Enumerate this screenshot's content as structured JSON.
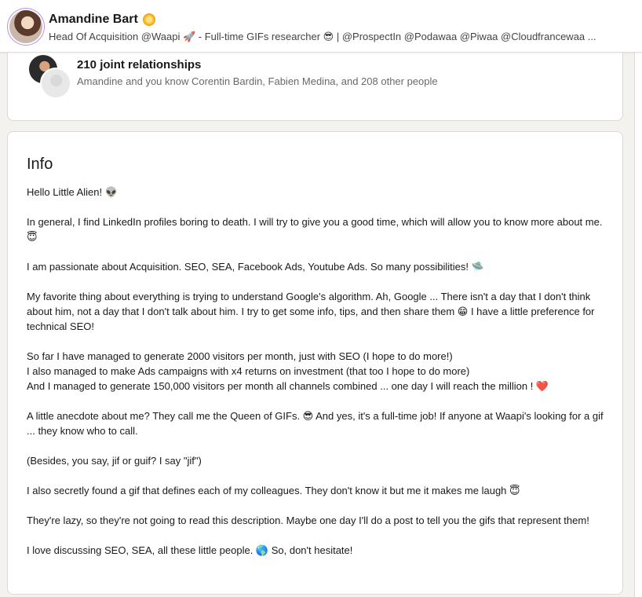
{
  "profile": {
    "name": "Amandine Bart",
    "headline": "Head Of Acquisition @Waapi 🚀 - Full-time GIFs researcher 😎 | @ProspectIn @Podawaa @Piwaa @Cloudfrancewaa ...",
    "badge_icon": "sun-badge-icon"
  },
  "relationships": {
    "title": "210 joint relationships",
    "subtitle": "Amandine and you know Corentin Bardin, Fabien Medina, and 208 other people"
  },
  "info": {
    "title": "Info",
    "paragraphs": [
      "Hello Little Alien! 👽",
      "In general, I find LinkedIn profiles boring to death. I will try to give you a good time, which will allow you to know more about me. 😇",
      "I am passionate about Acquisition. SEO, SEA, Facebook Ads, Youtube Ads. So many possibilities! 🛸",
      "My favorite thing about everything is trying to understand Google's algorithm. Ah, Google ... There isn't a day that I don't think about him, not a day that I don't talk about him. I try to get some info, tips, and then share them 😁 I have a little preference for technical SEO!",
      "So far I have managed to generate 2000 visitors per month, just with SEO (I hope to do more!)\nI also managed to make Ads campaigns with x4 returns on investment (that too I hope to do more)\nAnd I managed to generate 150,000 visitors per month all channels combined ... one day I will reach the million ! ❤️",
      "A little anecdote about me? They call me the Queen of GIFs. 😎 And yes, it's a full-time job! If anyone at Waapi's looking for a gif ... they know who to call.",
      "(Besides, you say, jif or guif? I say \"jif\")",
      "I also secretly found a gif that defines each of my colleagues. They don't know it but me it makes me laugh 😇",
      "They're lazy, so they're not going to read this description. Maybe one day I'll do a post to tell you the gifs that represent them!",
      "I love discussing SEO, SEA, all these little people. 🌎 So, don't hesitate!"
    ]
  }
}
